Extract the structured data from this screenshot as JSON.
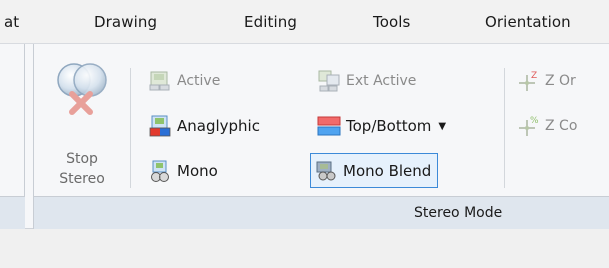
{
  "tabs": [
    {
      "label": "at"
    },
    {
      "label": "Drawing"
    },
    {
      "label": "Editing"
    },
    {
      "label": "Tools"
    },
    {
      "label": "Orientation"
    }
  ],
  "group": {
    "title": "Stereo Mode",
    "stop_stereo": {
      "line1": "Stop",
      "line2": "Stereo"
    },
    "active_label": "Active",
    "ext_active_label": "Ext Active",
    "anaglyphic_label": "Anaglyphic",
    "top_bottom_label": "Top/Bottom",
    "mono_label": "Mono",
    "mono_blend_label": "Mono Blend",
    "z_orbit_label": "Z Or",
    "z_co_label": "Z Co"
  },
  "colors": {
    "ribbon_bg": "#f6f7f9",
    "group_footer": "#dfe6ee",
    "selected_border": "#3c8ad8"
  }
}
